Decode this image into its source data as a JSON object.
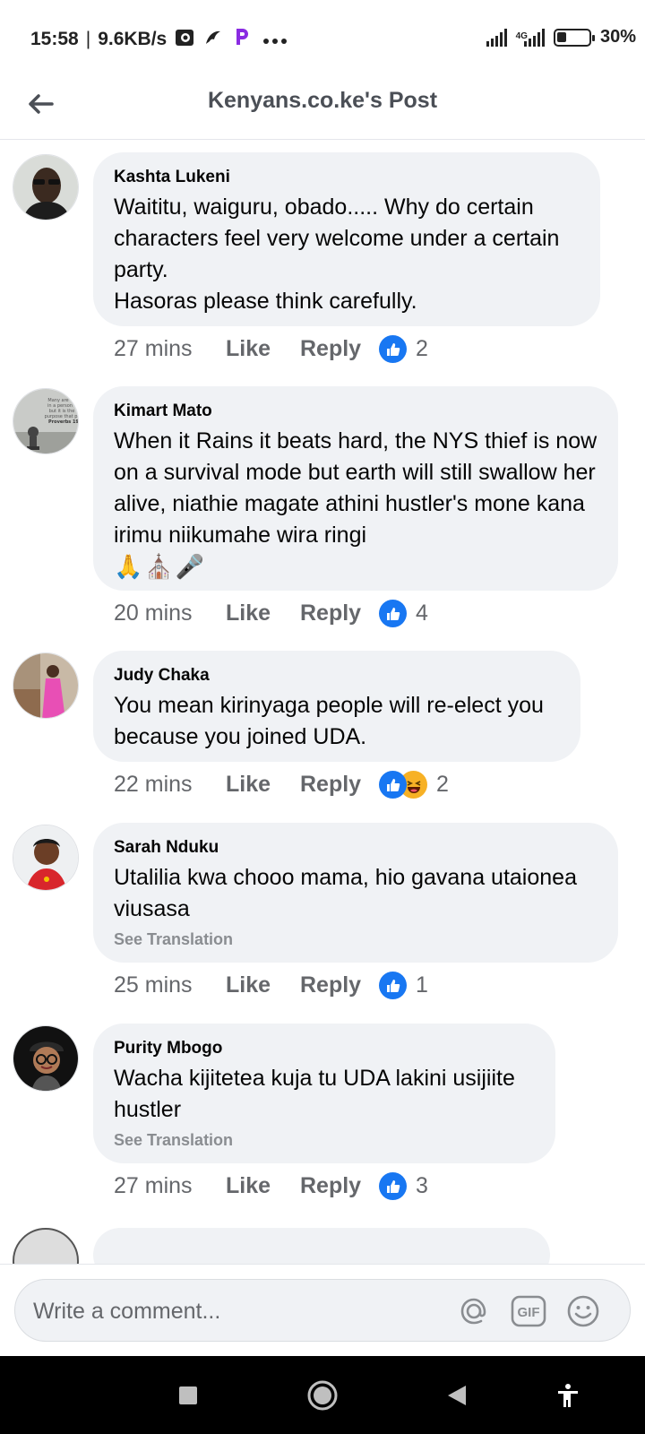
{
  "status_bar": {
    "time": "15:58",
    "speed": "9.6KB/s",
    "network_label": "4G",
    "battery": "30%",
    "battery_level": 0.3,
    "icons": [
      "news-app-icon",
      "bird-icon",
      "p-app-icon",
      "more-dots-icon",
      "signal-icon",
      "signal-4g-icon",
      "battery-icon"
    ]
  },
  "header": {
    "title": "Kenyans.co.ke's Post",
    "back_icon": "arrow-left-icon"
  },
  "comments": [
    {
      "author": "Kashta Lukeni",
      "text": "Waititu, waiguru, obado..... Why do certain characters feel very welcome under a certain party.\nHasoras please think carefully.",
      "time": "27 mins",
      "like": "Like",
      "reply": "Reply",
      "reactions": [
        "like"
      ],
      "reaction_count": "2"
    },
    {
      "author": "Kimart Mato",
      "text": "When it Rains it beats hard, the NYS thief is now on a survival mode but earth will still swallow her alive, niathie magate athini hustler's mone kana irimu niikumahe wira ringi",
      "emojis": "🙏⛪🎤",
      "avatar_text": "Many are in a person but it is the purpose that pr Proverbs 19",
      "time": "20 mins",
      "like": "Like",
      "reply": "Reply",
      "reactions": [
        "like"
      ],
      "reaction_count": "4"
    },
    {
      "author": "Judy Chaka",
      "text": "You mean kirinyaga people will re-elect you because you joined UDA.",
      "time": "22 mins",
      "like": "Like",
      "reply": "Reply",
      "reactions": [
        "like",
        "haha"
      ],
      "reaction_count": "2"
    },
    {
      "author": "Sarah Nduku",
      "text": "Utalilia kwa chooo mama, hio gavana utaionea viusasa",
      "see_translation": "See Translation",
      "time": "25 mins",
      "like": "Like",
      "reply": "Reply",
      "reactions": [
        "like"
      ],
      "reaction_count": "1"
    },
    {
      "author": "Purity Mbogo",
      "text": "Wacha kijitetea kuja tu UDA lakini usijiite hustler",
      "see_translation": "See Translation",
      "time": "27 mins",
      "like": "Like",
      "reply": "Reply",
      "reactions": [
        "like"
      ],
      "reaction_count": "3"
    }
  ],
  "composer": {
    "placeholder": "Write a comment...",
    "gif_label": "GIF",
    "icons": [
      "at-mention-icon",
      "gif-icon",
      "smiley-icon"
    ]
  },
  "nav_bar": {
    "icons": [
      "recents-square-icon",
      "home-circle-icon",
      "back-triangle-icon",
      "accessibility-icon"
    ]
  },
  "colors": {
    "bubble_bg": "#f0f2f5",
    "like_blue": "#1877f2",
    "meta_gray": "#65676b",
    "haha_yellow": "#f7b125"
  }
}
